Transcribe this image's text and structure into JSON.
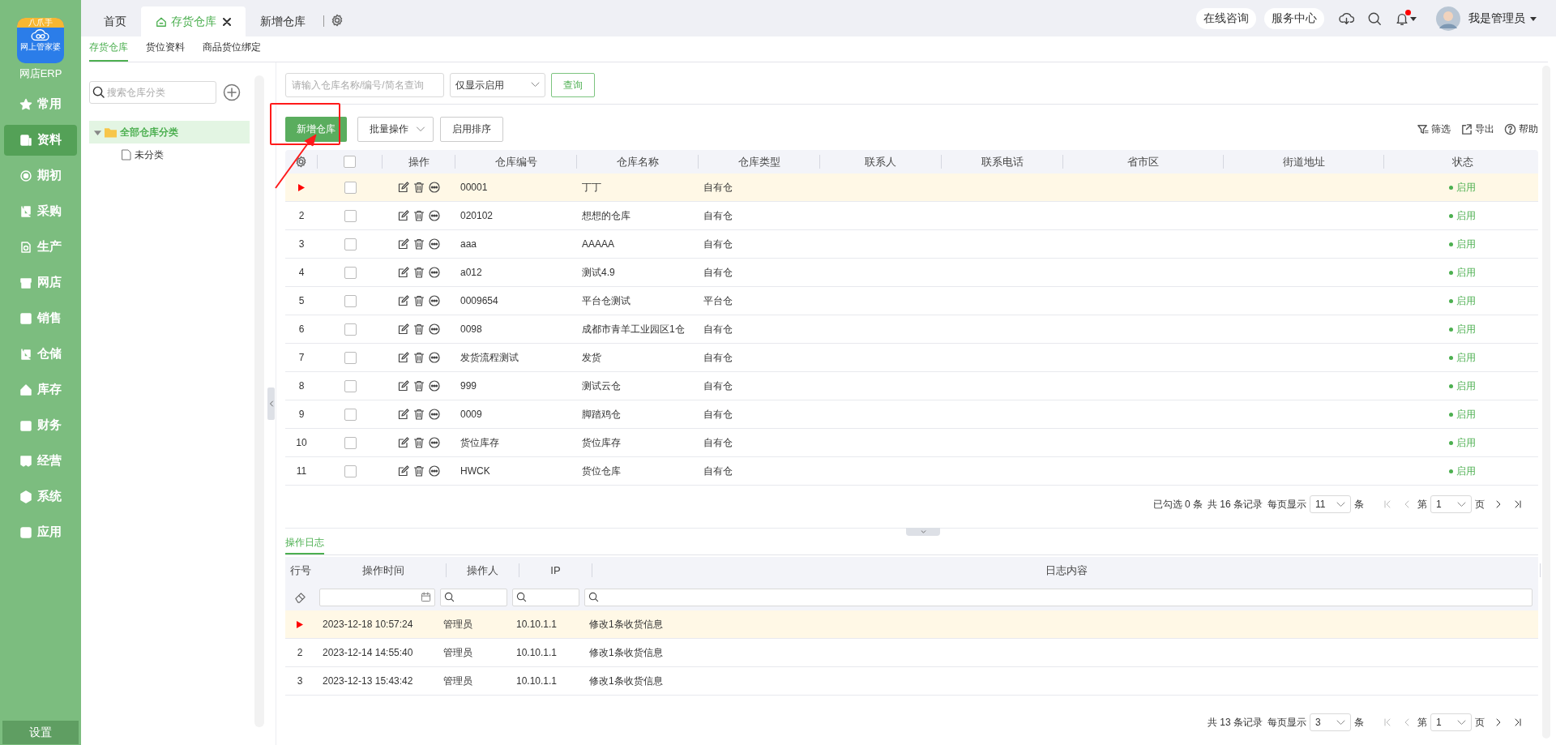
{
  "app": {
    "logo_badge": "八爪手",
    "logo_caption": "网上管家婆",
    "name": "网店ERP"
  },
  "sidebar": {
    "items": [
      {
        "label": "常用",
        "selected": false
      },
      {
        "label": "资料",
        "selected": true
      },
      {
        "label": "期初",
        "selected": false
      },
      {
        "label": "采购",
        "selected": false
      },
      {
        "label": "生产",
        "selected": false
      },
      {
        "label": "网店",
        "selected": false
      },
      {
        "label": "销售",
        "selected": false
      },
      {
        "label": "仓储",
        "selected": false
      },
      {
        "label": "库存",
        "selected": false
      },
      {
        "label": "财务",
        "selected": false
      },
      {
        "label": "经营",
        "selected": false
      },
      {
        "label": "系统",
        "selected": false
      },
      {
        "label": "应用",
        "selected": false
      }
    ],
    "footer": "设置"
  },
  "tabs": [
    {
      "label": "首页",
      "selected": false,
      "closable": false
    },
    {
      "label": "存货仓库",
      "selected": true,
      "closable": true
    },
    {
      "label": "新增仓库",
      "selected": false,
      "closable": false
    }
  ],
  "header": {
    "buttons": [
      "在线咨询",
      "服务中心"
    ],
    "user": "我是管理员",
    "notification": true
  },
  "subtabs": [
    {
      "label": "存货仓库",
      "selected": true
    },
    {
      "label": "货位资料",
      "selected": false
    },
    {
      "label": "商品货位绑定",
      "selected": false
    }
  ],
  "tree": {
    "search_placeholder": "搜索仓库分类",
    "items": [
      {
        "label": "全部仓库分类",
        "selected": true,
        "expanded": true,
        "children": [
          {
            "label": "未分类",
            "selected": false
          }
        ]
      }
    ]
  },
  "filter": {
    "search_placeholder": "请输入仓库名称/编号/简名查询",
    "status_select": "仅显示启用",
    "query_button": "查询"
  },
  "toolbar": {
    "buttons": [
      "新增仓库",
      "批量操作",
      "启用排序"
    ],
    "actions": [
      "筛选",
      "导出",
      "帮助"
    ]
  },
  "annotation": {
    "highlight": true
  },
  "table": {
    "all_checked": false,
    "columns": [
      "操作",
      "仓库编号",
      "仓库名称",
      "仓库类型",
      "联系人",
      "联系电话",
      "省市区",
      "街道地址",
      "状态"
    ],
    "rows": [
      {
        "selected": true,
        "checked": false,
        "code": "00001",
        "name": "丁丁",
        "type": "自有仓",
        "status": "启用"
      },
      {
        "selected": false,
        "number": "2",
        "checked": false,
        "code": "020102",
        "name": "想想的仓库",
        "type": "自有仓",
        "status": "启用"
      },
      {
        "selected": false,
        "number": "3",
        "checked": false,
        "code": "aaa",
        "name": "AAAAA",
        "type": "自有仓",
        "status": "启用"
      },
      {
        "selected": false,
        "number": "4",
        "checked": false,
        "code": "a012",
        "name": "测试4.9",
        "type": "自有仓",
        "status": "启用"
      },
      {
        "selected": false,
        "number": "5",
        "checked": false,
        "code": "0009654",
        "name": "平台仓测试",
        "type": "平台仓",
        "status": "启用"
      },
      {
        "selected": false,
        "number": "6",
        "checked": false,
        "code": "0098",
        "name": "成都市青羊工业园区1仓",
        "type": "自有仓",
        "status": "启用"
      },
      {
        "selected": false,
        "number": "7",
        "checked": false,
        "code": "发货流程测试",
        "name": "发货",
        "type": "自有仓",
        "status": "启用"
      },
      {
        "selected": false,
        "number": "8",
        "checked": false,
        "code": "999",
        "name": "测试云仓",
        "type": "自有仓",
        "status": "启用"
      },
      {
        "selected": false,
        "number": "9",
        "checked": false,
        "code": "0009",
        "name": "脚踏鸡仓",
        "type": "自有仓",
        "status": "启用"
      },
      {
        "selected": false,
        "number": "10",
        "checked": false,
        "code": "货位库存",
        "name": "货位库存",
        "type": "自有仓",
        "status": "启用"
      },
      {
        "selected": false,
        "number": "11",
        "checked": false,
        "code": "HWCK",
        "name": "货位仓库",
        "type": "自有仓",
        "status": "启用"
      }
    ]
  },
  "pagination": {
    "selected_count": "已勾选 0 条",
    "total": "共 16 条记录",
    "per_page_label": "每页显示",
    "per_page": "11",
    "unit": "条",
    "page_prefix": "第",
    "page": "1",
    "page_suffix": "页"
  },
  "log": {
    "tab": "操作日志",
    "columns": [
      "行号",
      "操作时间",
      "操作人",
      "IP",
      "日志内容"
    ],
    "rows": [
      {
        "selected": true,
        "time": "2023-12-18 10:57:24",
        "user": "管理员",
        "ip": "10.10.1.1",
        "content": "修改1条收货信息"
      },
      {
        "selected": false,
        "number": "2",
        "time": "2023-12-14 14:55:40",
        "user": "管理员",
        "ip": "10.10.1.1",
        "content": "修改1条收货信息"
      },
      {
        "selected": false,
        "number": "3",
        "time": "2023-12-13 15:43:42",
        "user": "管理员",
        "ip": "10.10.1.1",
        "content": "修改1条收货信息"
      }
    ],
    "pagination": {
      "total": "共 13 条记录",
      "per_page_label": "每页显示",
      "per_page": "3",
      "unit": "条",
      "page_prefix": "第",
      "page": "1",
      "page_suffix": "页"
    }
  }
}
